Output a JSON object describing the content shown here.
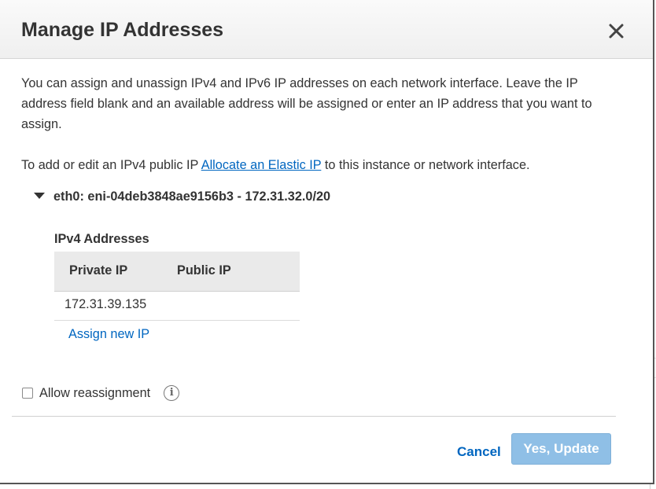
{
  "dialog": {
    "title": "Manage IP Addresses",
    "intro": "You can assign and unassign IPv4 and IPv6 IP addresses on each network interface. Leave the IP address field blank and an available address will be assigned or enter an IP address that you want to assign.",
    "elastic_prefix": "To add or edit an IPv4 public IP",
    "elastic_link": "Allocate an Elastic IP",
    "elastic_suffix": "to this instance or network interface."
  },
  "interface": {
    "label": "eth0: eni-04deb3848ae9156b3 - 172.31.32.0/20",
    "section_label": "IPv4 Addresses",
    "columns": [
      "Private IP",
      "Public IP"
    ],
    "rows": [
      {
        "private_ip": "172.31.39.135",
        "public_ip": ""
      }
    ],
    "assign_new": "Assign new IP"
  },
  "options": {
    "allow_reassignment": "Allow reassignment",
    "allow_reassignment_checked": false,
    "info_glyph": "i"
  },
  "footer": {
    "cancel": "Cancel",
    "confirm": "Yes, Update"
  },
  "colors": {
    "link": "#0066c0",
    "primary_button_disabled": "#8fbfe6",
    "header_bg": "#f3f3f3"
  },
  "icons": [
    "close-icon",
    "caret-down-icon",
    "info-icon",
    "checkbox"
  ]
}
